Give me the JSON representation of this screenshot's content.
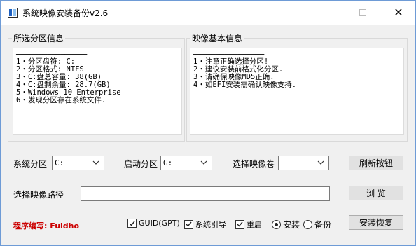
{
  "window": {
    "title": "系统映像安装备份v2.6",
    "minimize_glyph": "",
    "maximize_glyph": "",
    "close_glyph": "✕"
  },
  "partition_info": {
    "group_label": "所选分区信息",
    "separator": "════════════════",
    "lines": [
      "1・分区盘符: C:",
      "2・分区格式: NTFS",
      "3・C:盘总容量: 38(GB)",
      "4・C:盘剩余量: 28.7(GB)",
      "5・Windows 10 Enterprise",
      "6・发现分区存在系统文件."
    ]
  },
  "image_info": {
    "group_label": "映像基本信息",
    "separator": "════════════════",
    "lines": [
      "1・注意正确选择分区!",
      "2・建议安装前格式化分区.",
      "3・请确保映像MD5正确.",
      "4・如EFI安装需确认映像支持."
    ]
  },
  "controls": {
    "system_partition_label": "系统分区",
    "system_partition_value": "C:",
    "boot_partition_label": "启动分区",
    "boot_partition_value": "G:",
    "image_volume_label": "选择映像卷",
    "image_volume_value": "",
    "refresh_button": "刷新按钮",
    "image_path_label": "选择映像路径",
    "image_path_value": "",
    "browse_button": "浏 览",
    "author": "程序编写: Fuldho",
    "guid_check": "GUID(GPT)",
    "guid_checked": true,
    "sysboot_check": "系统引导",
    "sysboot_checked": true,
    "restart_check": "重启",
    "restart_checked": true,
    "install_radio": "安装",
    "install_selected": true,
    "backup_radio": "备份",
    "backup_selected": false,
    "action_button": "安装恢复"
  },
  "icons": {
    "app": "app-icon",
    "dropdown": "chevron-down-icon",
    "checkmark": "checkmark-icon"
  }
}
